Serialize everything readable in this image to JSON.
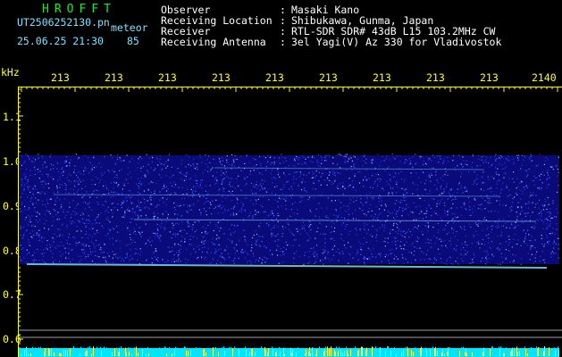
{
  "header": {
    "title": "HROFFT",
    "file_name": "UT2506252130.pn",
    "mode": "meteor",
    "datetime": "25.06.25 21:30",
    "count": "85",
    "fields": [
      {
        "label": "Observer",
        "value": "Masaki Kano"
      },
      {
        "label": "Receiving Location",
        "value": "Shibukawa, Gunma, Japan"
      },
      {
        "label": "Receiver",
        "value": "RTL-SDR SDR# 43dB L15 103.2MHz CW"
      },
      {
        "label": "Receiving Antenna",
        "value": "3el Yagi(V) Az 330 for Vladivostok"
      }
    ],
    "separator": ":"
  },
  "axes": {
    "y_unit": "kHz",
    "y_ticks": [
      "1.1",
      "1.0",
      "0.9",
      "0.8",
      "0.7",
      "0.6"
    ],
    "x_ticks": [
      "213",
      "213",
      "213",
      "213",
      "213",
      "213",
      "213",
      "213",
      "213",
      "2140"
    ]
  },
  "colors": {
    "label_text": "#ffffff",
    "title_text": "#26e23a",
    "filename_text": "#7fe0ff",
    "axis": "#ffff30",
    "spectrum_dark": "#0a0a7a",
    "spectrum_bright": "#4a6bff",
    "trace": "#7fd8ff",
    "level_bar": "#00e5ff"
  }
}
